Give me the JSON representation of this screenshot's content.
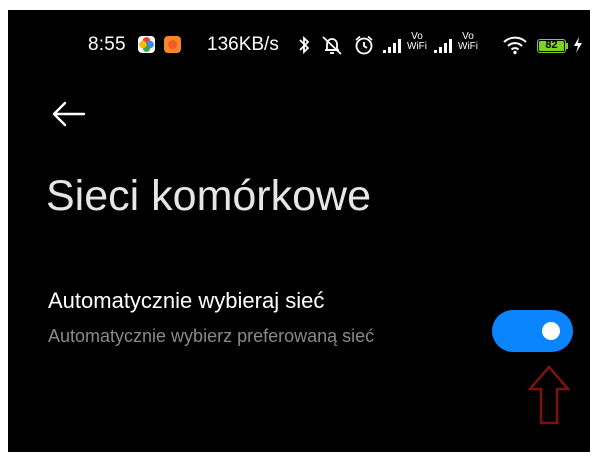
{
  "status_bar": {
    "time": "8:55",
    "net_speed": "136KB/s",
    "battery": "82",
    "icons": [
      "photos-icon",
      "app-icon",
      "bluetooth-icon",
      "mute-icon",
      "alarm-icon",
      "signal-icon",
      "vowifi-icon",
      "signal-icon",
      "vowifi-icon",
      "wifi-icon",
      "battery-icon",
      "charging-icon"
    ],
    "vowifi_top": "Vo",
    "vowifi_bottom": "WiFi"
  },
  "header": {
    "back_icon": "arrow-left-icon",
    "title": "Sieci komórkowe"
  },
  "settings": {
    "auto_select": {
      "title": "Automatycznie wybieraj sieć",
      "subtitle": "Automatycznie wybierz preferowaną sieć",
      "enabled": true
    }
  },
  "colors": {
    "background": "#000000",
    "toggle_on": "#0a84ff",
    "annotation_arrow": "#7a1212",
    "battery": "#7ed321"
  }
}
